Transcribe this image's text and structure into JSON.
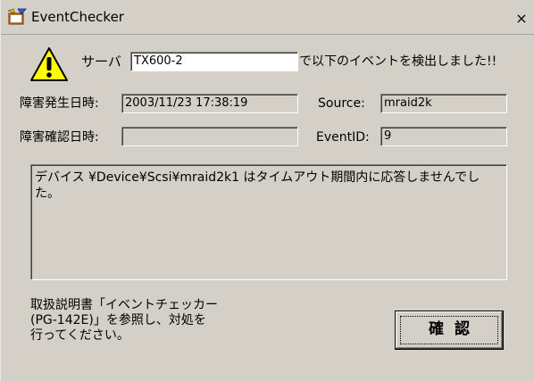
{
  "window": {
    "title": "EventChecker",
    "close_glyph": "×"
  },
  "icons": {
    "app": "event-checker-app-icon",
    "warning": "warning-triangle-icon",
    "close": "close-icon"
  },
  "server": {
    "label": "サーバ",
    "value": "TX600-2",
    "suffix": "で以下のイベントを検出しました!!"
  },
  "details": {
    "occurred_label": "障害発生日時:",
    "occurred_value": "2003/11/23 17:38:19",
    "confirmed_label": "障害確認日時:",
    "confirmed_value": "",
    "source_label": "Source:",
    "source_value": "mraid2k",
    "eventid_label": "EventID:",
    "eventid_value": "9"
  },
  "message": {
    "text": "デバイス ¥Device¥Scsi¥mraid2k1 はタイムアウト期間内に応答しませんでした。"
  },
  "note": {
    "text": "取扱説明書「イベントチェッカー\n(PG-142E)」を参照し、対処を\n行ってください。"
  },
  "button": {
    "label": "確認"
  },
  "colors": {
    "face": "#d4d0c8",
    "warning_fill": "#ffff00"
  }
}
